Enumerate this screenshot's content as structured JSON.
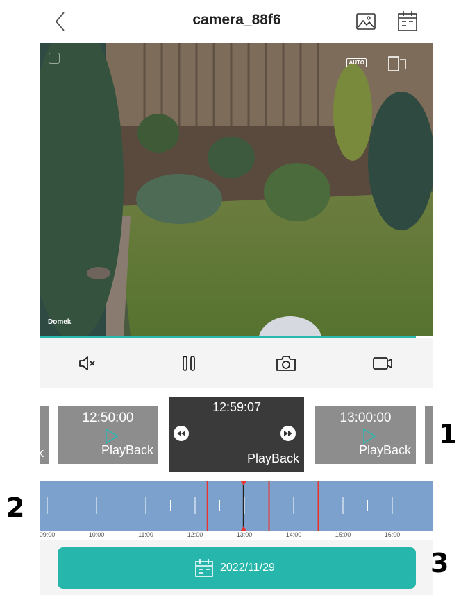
{
  "header": {
    "title": "camera_88f6"
  },
  "video": {
    "camera_label": "Domek",
    "auto_badge": "AUTO",
    "playback_position": 0.955
  },
  "controls": {
    "mute_icon": "speaker-muted-icon",
    "pause_icon": "pause-icon",
    "snapshot_icon": "camera-icon",
    "record_icon": "video-record-icon"
  },
  "thumbnails": {
    "left_fragment": "k",
    "items": [
      {
        "time": "12:50:00",
        "label": "PlayBack"
      },
      {
        "time": "12:59:07",
        "label": "PlayBack"
      },
      {
        "time": "13:00:00",
        "label": "PlayBack"
      }
    ]
  },
  "timeline": {
    "labels": [
      "09:00",
      "10:00",
      "11:00",
      "12:00",
      "13:00",
      "14:00",
      "15:00",
      "16:00"
    ],
    "cursor_time": "12:59",
    "events": [
      "12:15",
      "13:30",
      "14:30"
    ],
    "colors": {
      "bar": "#7da1cd",
      "event": "#e8332c",
      "cursor": "#e8332c"
    }
  },
  "date_button": {
    "date": "2022/11/29"
  },
  "annotations": [
    "1",
    "2",
    "3"
  ],
  "theme": {
    "accent": "#26b6ab",
    "progress": "#2ab8b0"
  }
}
